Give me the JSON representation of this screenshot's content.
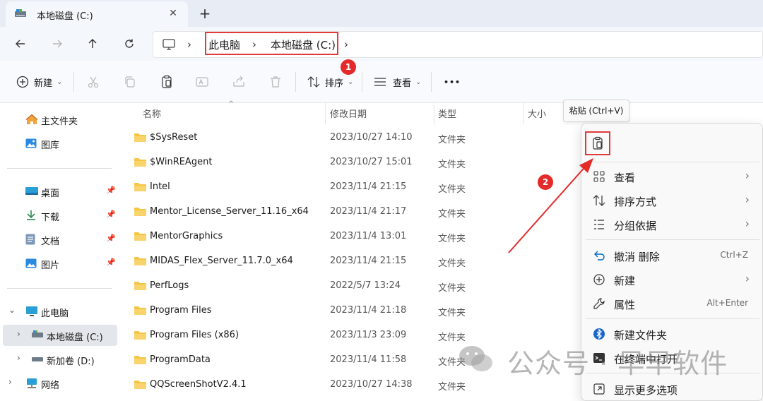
{
  "tab": {
    "title": "本地磁盘 (C:)",
    "close": "✕",
    "new_tab": "+"
  },
  "address": {
    "crumbs": [
      "此电脑",
      "本地磁盘 (C:)"
    ],
    "separator": "›"
  },
  "badges": {
    "one": "1",
    "two": "2"
  },
  "toolbar": {
    "new_label": "新建",
    "sort_label": "排序",
    "view_label": "查看",
    "more_label": "•••"
  },
  "sidebar": {
    "items": [
      {
        "label": "主文件夹",
        "icon": "home-icon"
      },
      {
        "label": "图库",
        "icon": "gallery-icon"
      },
      {
        "label": "桌面",
        "icon": "desktop-icon"
      },
      {
        "label": "下载",
        "icon": "download-icon"
      },
      {
        "label": "文档",
        "icon": "document-icon"
      },
      {
        "label": "图片",
        "icon": "pictures-icon"
      },
      {
        "label": "此电脑",
        "icon": "pc-icon"
      },
      {
        "label": "本地磁盘 (C:)",
        "icon": "drive-icon"
      },
      {
        "label": "新加卷 (D:)",
        "icon": "drive-icon"
      },
      {
        "label": "网络",
        "icon": "network-icon"
      }
    ]
  },
  "columns": {
    "name": "名称",
    "modified": "修改日期",
    "type": "类型",
    "size": "大小"
  },
  "files": [
    {
      "name": "$SysReset",
      "date": "2023/10/27 14:10",
      "type": "文件夹"
    },
    {
      "name": "$WinREAgent",
      "date": "2023/10/27 15:01",
      "type": "文件夹"
    },
    {
      "name": "Intel",
      "date": "2023/11/4 21:15",
      "type": "文件夹"
    },
    {
      "name": "Mentor_License_Server_11.16_x64",
      "date": "2023/11/4 21:17",
      "type": "文件夹"
    },
    {
      "name": "MentorGraphics",
      "date": "2023/11/4 13:01",
      "type": "文件夹"
    },
    {
      "name": "MIDAS_Flex_Server_11.7.0_x64",
      "date": "2023/11/4 21:15",
      "type": "文件夹"
    },
    {
      "name": "PerfLogs",
      "date": "2022/5/7 13:24",
      "type": "文件夹"
    },
    {
      "name": "Program Files",
      "date": "2023/11/4 21:18",
      "type": "文件夹"
    },
    {
      "name": "Program Files (x86)",
      "date": "2023/11/3 23:09",
      "type": "文件夹"
    },
    {
      "name": "ProgramData",
      "date": "2023/11/4 11:58",
      "type": "文件夹"
    },
    {
      "name": "QQScreenShotV2.4.1",
      "date": "2023/10/27 14:38",
      "type": "文件夹"
    }
  ],
  "tooltip": {
    "text": "粘贴 (Ctrl+V)"
  },
  "context_menu": {
    "items": [
      {
        "label": "查看",
        "icon": "grid-icon",
        "shortcut": "",
        "submenu": true
      },
      {
        "label": "排序方式",
        "icon": "sort-icon",
        "shortcut": "",
        "submenu": true
      },
      {
        "label": "分组依据",
        "icon": "group-icon",
        "shortcut": "",
        "submenu": true
      },
      {
        "label": "撤消 删除",
        "icon": "undo-icon",
        "shortcut": "Ctrl+Z",
        "submenu": false
      },
      {
        "label": "新建",
        "icon": "plus-circle-icon",
        "shortcut": "",
        "submenu": true
      },
      {
        "label": "属性",
        "icon": "wrench-icon",
        "shortcut": "Alt+Enter",
        "submenu": false
      },
      {
        "label": "新建文件夹",
        "icon": "bluetooth-folder-icon",
        "shortcut": "",
        "submenu": false
      },
      {
        "label": "在终端中打开",
        "icon": "terminal-icon",
        "shortcut": "",
        "submenu": false
      },
      {
        "label": "显示更多选项",
        "icon": "more-options-icon",
        "shortcut": "",
        "submenu": false
      }
    ],
    "submenu_arrow": "›"
  },
  "watermark": {
    "text": "公众号 · 早早软件"
  },
  "colors": {
    "accent": "#0067c0",
    "highlight": "#e03a3a",
    "folder": "#f6c543"
  }
}
